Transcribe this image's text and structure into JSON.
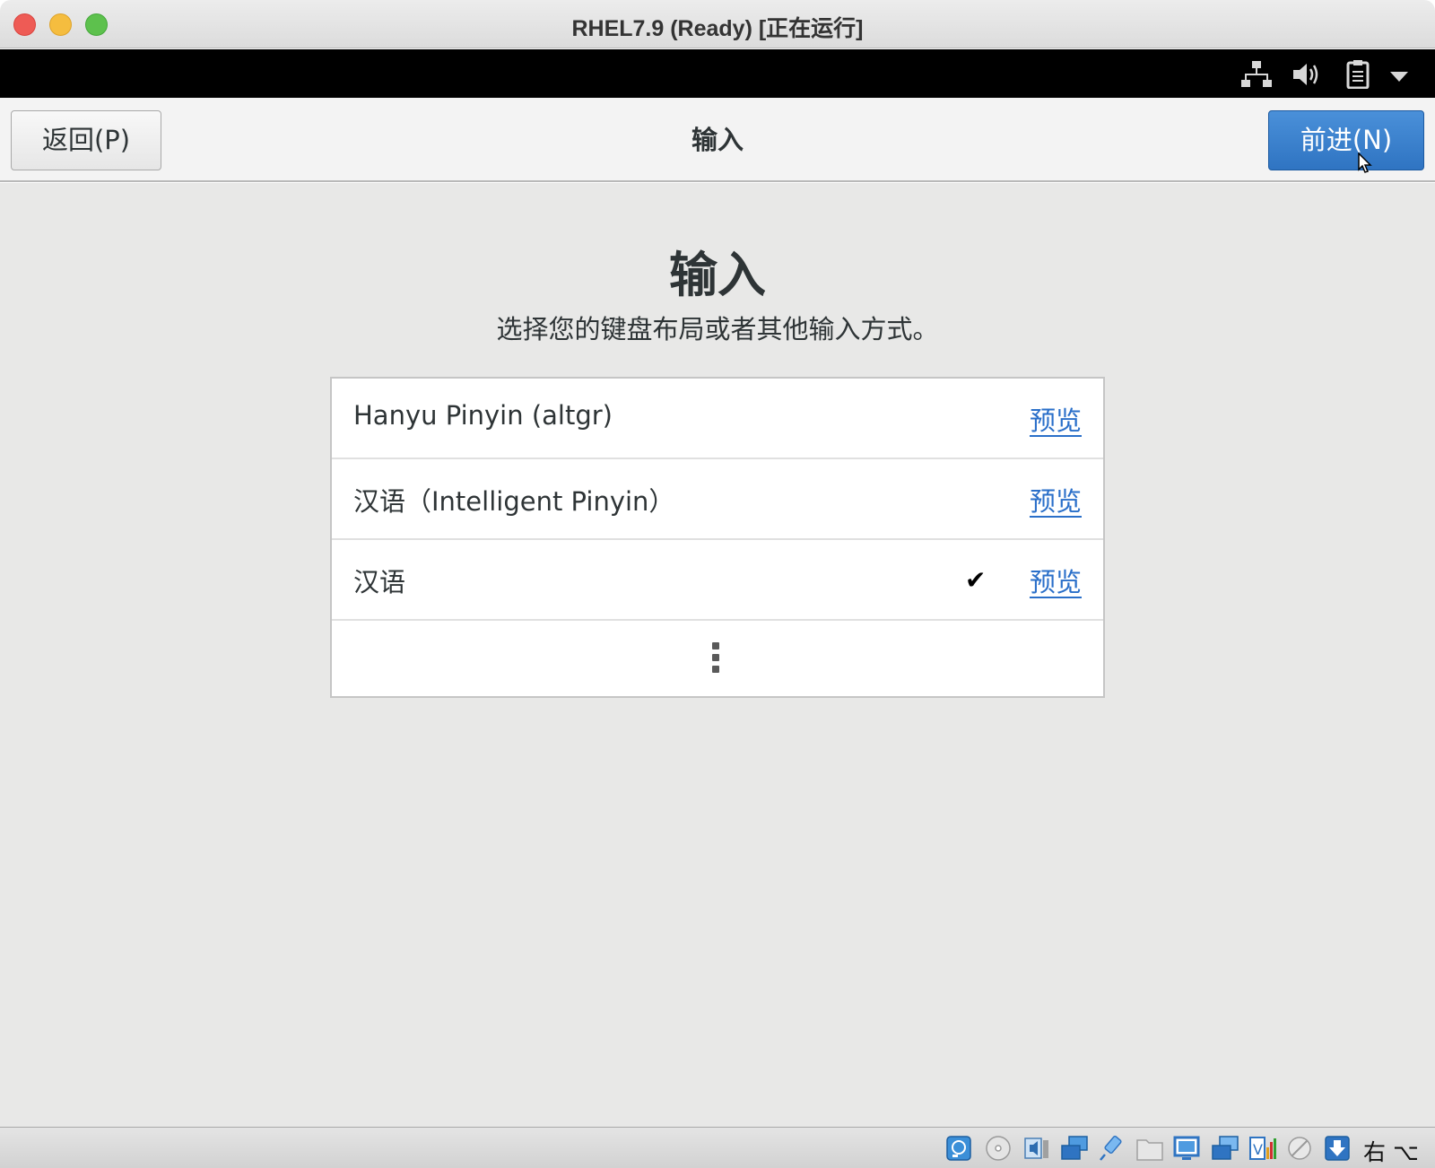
{
  "window": {
    "title": "RHEL7.9 (Ready) [正在运行]"
  },
  "panel": {
    "icons": [
      "network-icon",
      "volume-icon",
      "clipboard-icon",
      "dropdown-arrow-icon"
    ]
  },
  "header": {
    "back_label": "返回(P)",
    "title": "输入",
    "next_label": "前进(N)"
  },
  "page": {
    "heading": "输入",
    "subtitle": "选择您的键盘布局或者其他输入方式。"
  },
  "input_sources": [
    {
      "label": "Hanyu Pinyin (altgr)",
      "selected": false,
      "preview_label": "预览"
    },
    {
      "label": "汉语（Intelligent Pinyin）",
      "selected": false,
      "preview_label": "预览"
    },
    {
      "label": "汉语",
      "selected": true,
      "preview_label": "预览"
    }
  ],
  "selected_mark": "✔",
  "statusbar": {
    "icons": [
      "hard-disk-icon",
      "optical-disk-icon",
      "audio-icon",
      "network-adapter-icon",
      "usb-icon",
      "shared-folder-icon",
      "display-icon",
      "snapshot-icon",
      "video-capture-icon",
      "mouse-integration-icon",
      "download-icon"
    ],
    "host_key_label": "右 ⌥"
  },
  "colors": {
    "accent_blue": "#2f74c2",
    "link_blue": "#2a6fc9",
    "panel_black": "#000000",
    "content_bg": "#e8e8e7"
  }
}
